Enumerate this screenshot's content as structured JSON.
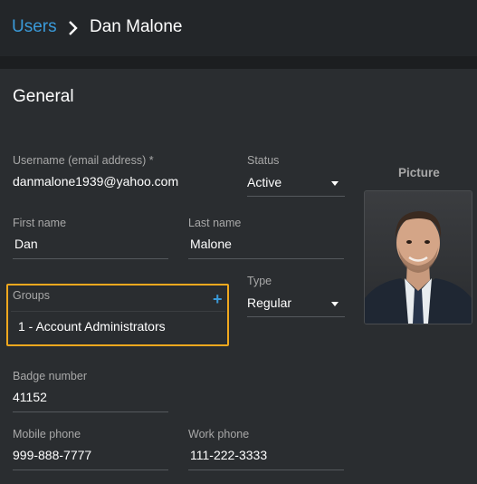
{
  "breadcrumb": {
    "parent": "Users",
    "current": "Dan Malone"
  },
  "section": {
    "title": "General"
  },
  "fields": {
    "username": {
      "label": "Username (email address) *",
      "value": "danmalone1939@yahoo.com"
    },
    "status": {
      "label": "Status",
      "value": "Active"
    },
    "first_name": {
      "label": "First name",
      "value": "Dan"
    },
    "last_name": {
      "label": "Last name",
      "value": "Malone"
    },
    "groups": {
      "label": "Groups",
      "value": "1 - Account Administrators"
    },
    "type": {
      "label": "Type",
      "value": "Regular"
    },
    "badge": {
      "label": "Badge number",
      "value": "41152"
    },
    "mobile": {
      "label": "Mobile phone",
      "value": "999-888-7777"
    },
    "work": {
      "label": "Work phone",
      "value": "111-222-3333"
    }
  },
  "picture": {
    "label": "Picture"
  },
  "colors": {
    "accent": "#3a9ad9",
    "highlight": "#f0a81e",
    "background": "#2a2d30"
  }
}
